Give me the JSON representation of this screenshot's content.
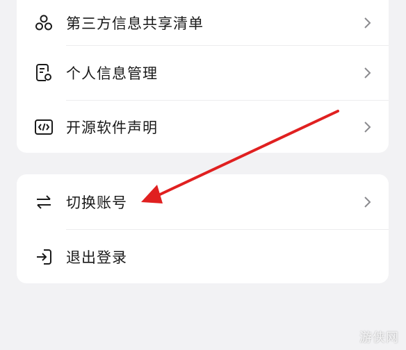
{
  "settings_list": {
    "items": [
      {
        "label": "第三方信息共享清单",
        "icon": "share-network-icon"
      },
      {
        "label": "个人信息管理",
        "icon": "document-settings-icon"
      },
      {
        "label": "开源软件声明",
        "icon": "code-icon"
      }
    ]
  },
  "account_list": {
    "items": [
      {
        "label": "切换账号",
        "icon": "swap-arrows-icon"
      },
      {
        "label": "退出登录",
        "icon": "logout-icon"
      }
    ]
  },
  "annotation": {
    "arrow_color": "#e02020"
  },
  "watermark": {
    "text": "游侠网"
  }
}
